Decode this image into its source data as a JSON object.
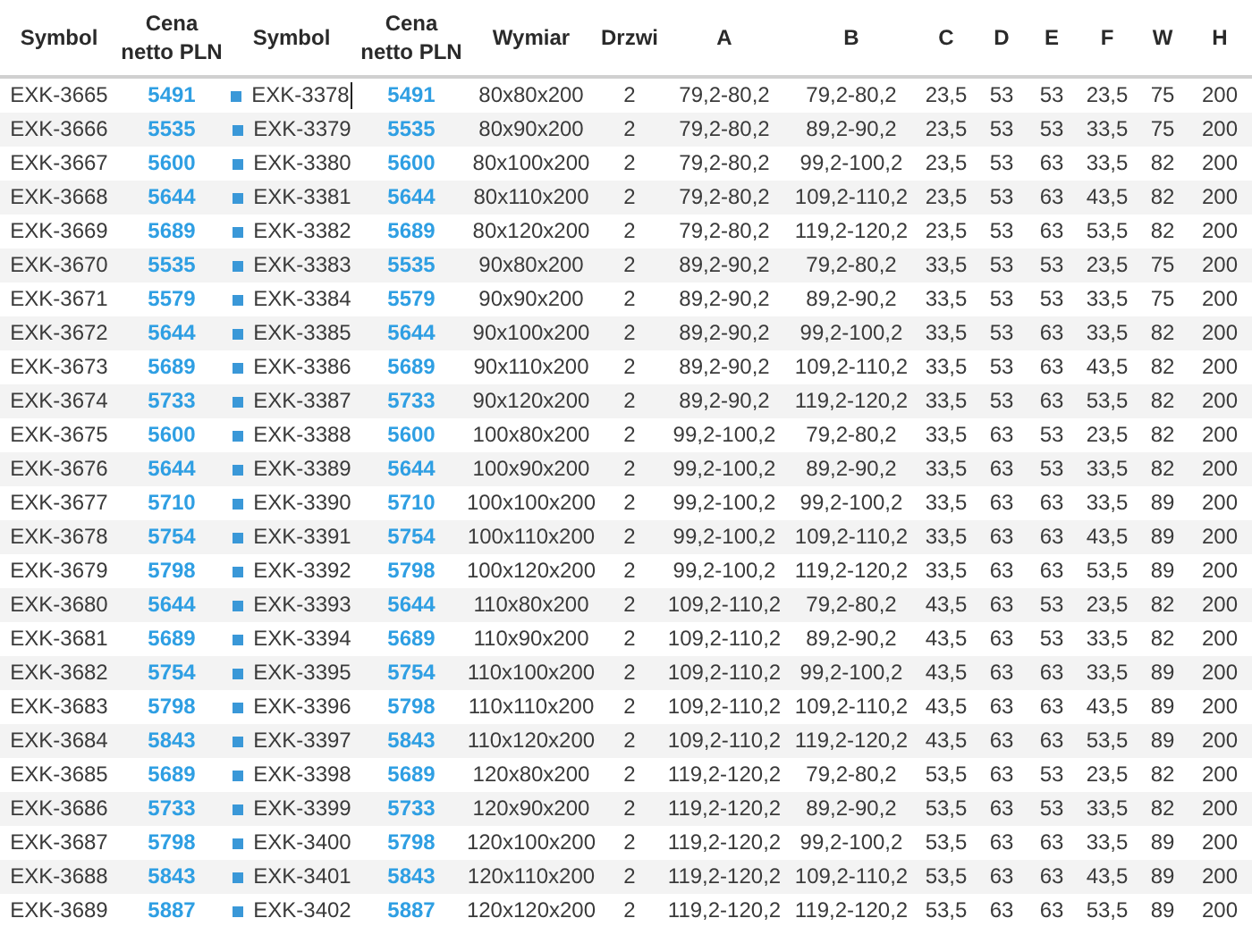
{
  "table": {
    "columns": [
      {
        "label": "Symbol",
        "kind": "text"
      },
      {
        "label": "Cena netto PLN",
        "kind": "price"
      },
      {
        "label": "Symbol",
        "kind": "marked"
      },
      {
        "label": "Cena netto PLN",
        "kind": "price"
      },
      {
        "label": "Wymiar",
        "kind": "text"
      },
      {
        "label": "Drzwi",
        "kind": "text"
      },
      {
        "label": "A",
        "kind": "text"
      },
      {
        "label": "B",
        "kind": "text"
      },
      {
        "label": "C",
        "kind": "text"
      },
      {
        "label": "D",
        "kind": "text"
      },
      {
        "label": "E",
        "kind": "text"
      },
      {
        "label": "F",
        "kind": "text"
      },
      {
        "label": "W",
        "kind": "text"
      },
      {
        "label": "H",
        "kind": "text"
      }
    ],
    "rows": [
      {
        "editing": true,
        "cells": [
          "EXK-3665",
          "5491",
          "EXK-3378",
          "5491",
          "80x80x200",
          "2",
          "79,2-80,2",
          "79,2-80,2",
          "23,5",
          "53",
          "53",
          "23,5",
          "75",
          "200"
        ]
      },
      {
        "editing": false,
        "cells": [
          "EXK-3666",
          "5535",
          "EXK-3379",
          "5535",
          "80x90x200",
          "2",
          "79,2-80,2",
          "89,2-90,2",
          "23,5",
          "53",
          "53",
          "33,5",
          "75",
          "200"
        ]
      },
      {
        "editing": false,
        "cells": [
          "EXK-3667",
          "5600",
          "EXK-3380",
          "5600",
          "80x100x200",
          "2",
          "79,2-80,2",
          "99,2-100,2",
          "23,5",
          "53",
          "63",
          "33,5",
          "82",
          "200"
        ]
      },
      {
        "editing": false,
        "cells": [
          "EXK-3668",
          "5644",
          "EXK-3381",
          "5644",
          "80x110x200",
          "2",
          "79,2-80,2",
          "109,2-110,2",
          "23,5",
          "53",
          "63",
          "43,5",
          "82",
          "200"
        ]
      },
      {
        "editing": false,
        "cells": [
          "EXK-3669",
          "5689",
          "EXK-3382",
          "5689",
          "80x120x200",
          "2",
          "79,2-80,2",
          "119,2-120,2",
          "23,5",
          "53",
          "63",
          "53,5",
          "82",
          "200"
        ]
      },
      {
        "editing": false,
        "cells": [
          "EXK-3670",
          "5535",
          "EXK-3383",
          "5535",
          "90x80x200",
          "2",
          "89,2-90,2",
          "79,2-80,2",
          "33,5",
          "53",
          "53",
          "23,5",
          "75",
          "200"
        ]
      },
      {
        "editing": false,
        "cells": [
          "EXK-3671",
          "5579",
          "EXK-3384",
          "5579",
          "90x90x200",
          "2",
          "89,2-90,2",
          "89,2-90,2",
          "33,5",
          "53",
          "53",
          "33,5",
          "75",
          "200"
        ]
      },
      {
        "editing": false,
        "cells": [
          "EXK-3672",
          "5644",
          "EXK-3385",
          "5644",
          "90x100x200",
          "2",
          "89,2-90,2",
          "99,2-100,2",
          "33,5",
          "53",
          "63",
          "33,5",
          "82",
          "200"
        ]
      },
      {
        "editing": false,
        "cells": [
          "EXK-3673",
          "5689",
          "EXK-3386",
          "5689",
          "90x110x200",
          "2",
          "89,2-90,2",
          "109,2-110,2",
          "33,5",
          "53",
          "63",
          "43,5",
          "82",
          "200"
        ]
      },
      {
        "editing": false,
        "cells": [
          "EXK-3674",
          "5733",
          "EXK-3387",
          "5733",
          "90x120x200",
          "2",
          "89,2-90,2",
          "119,2-120,2",
          "33,5",
          "53",
          "63",
          "53,5",
          "82",
          "200"
        ]
      },
      {
        "editing": false,
        "cells": [
          "EXK-3675",
          "5600",
          "EXK-3388",
          "5600",
          "100x80x200",
          "2",
          "99,2-100,2",
          "79,2-80,2",
          "33,5",
          "63",
          "53",
          "23,5",
          "82",
          "200"
        ]
      },
      {
        "editing": false,
        "cells": [
          "EXK-3676",
          "5644",
          "EXK-3389",
          "5644",
          "100x90x200",
          "2",
          "99,2-100,2",
          "89,2-90,2",
          "33,5",
          "63",
          "53",
          "33,5",
          "82",
          "200"
        ]
      },
      {
        "editing": false,
        "cells": [
          "EXK-3677",
          "5710",
          "EXK-3390",
          "5710",
          "100x100x200",
          "2",
          "99,2-100,2",
          "99,2-100,2",
          "33,5",
          "63",
          "63",
          "33,5",
          "89",
          "200"
        ]
      },
      {
        "editing": false,
        "cells": [
          "EXK-3678",
          "5754",
          "EXK-3391",
          "5754",
          "100x110x200",
          "2",
          "99,2-100,2",
          "109,2-110,2",
          "33,5",
          "63",
          "63",
          "43,5",
          "89",
          "200"
        ]
      },
      {
        "editing": false,
        "cells": [
          "EXK-3679",
          "5798",
          "EXK-3392",
          "5798",
          "100x120x200",
          "2",
          "99,2-100,2",
          "119,2-120,2",
          "33,5",
          "63",
          "63",
          "53,5",
          "89",
          "200"
        ]
      },
      {
        "editing": false,
        "cells": [
          "EXK-3680",
          "5644",
          "EXK-3393",
          "5644",
          "110x80x200",
          "2",
          "109,2-110,2",
          "79,2-80,2",
          "43,5",
          "63",
          "53",
          "23,5",
          "82",
          "200"
        ]
      },
      {
        "editing": false,
        "cells": [
          "EXK-3681",
          "5689",
          "EXK-3394",
          "5689",
          "110x90x200",
          "2",
          "109,2-110,2",
          "89,2-90,2",
          "43,5",
          "63",
          "53",
          "33,5",
          "82",
          "200"
        ]
      },
      {
        "editing": false,
        "cells": [
          "EXK-3682",
          "5754",
          "EXK-3395",
          "5754",
          "110x100x200",
          "2",
          "109,2-110,2",
          "99,2-100,2",
          "43,5",
          "63",
          "63",
          "33,5",
          "89",
          "200"
        ]
      },
      {
        "editing": false,
        "cells": [
          "EXK-3683",
          "5798",
          "EXK-3396",
          "5798",
          "110x110x200",
          "2",
          "109,2-110,2",
          "109,2-110,2",
          "43,5",
          "63",
          "63",
          "43,5",
          "89",
          "200"
        ]
      },
      {
        "editing": false,
        "cells": [
          "EXK-3684",
          "5843",
          "EXK-3397",
          "5843",
          "110x120x200",
          "2",
          "109,2-110,2",
          "119,2-120,2",
          "43,5",
          "63",
          "63",
          "53,5",
          "89",
          "200"
        ]
      },
      {
        "editing": false,
        "cells": [
          "EXK-3685",
          "5689",
          "EXK-3398",
          "5689",
          "120x80x200",
          "2",
          "119,2-120,2",
          "79,2-80,2",
          "53,5",
          "63",
          "53",
          "23,5",
          "82",
          "200"
        ]
      },
      {
        "editing": false,
        "cells": [
          "EXK-3686",
          "5733",
          "EXK-3399",
          "5733",
          "120x90x200",
          "2",
          "119,2-120,2",
          "89,2-90,2",
          "53,5",
          "63",
          "53",
          "33,5",
          "82",
          "200"
        ]
      },
      {
        "editing": false,
        "cells": [
          "EXK-3687",
          "5798",
          "EXK-3400",
          "5798",
          "120x100x200",
          "2",
          "119,2-120,2",
          "99,2-100,2",
          "53,5",
          "63",
          "63",
          "33,5",
          "89",
          "200"
        ]
      },
      {
        "editing": false,
        "cells": [
          "EXK-3688",
          "5843",
          "EXK-3401",
          "5843",
          "120x110x200",
          "2",
          "119,2-120,2",
          "109,2-110,2",
          "53,5",
          "63",
          "63",
          "43,5",
          "89",
          "200"
        ]
      },
      {
        "editing": false,
        "cells": [
          "EXK-3689",
          "5887",
          "EXK-3402",
          "5887",
          "120x120x200",
          "2",
          "119,2-120,2",
          "119,2-120,2",
          "53,5",
          "63",
          "63",
          "53,5",
          "89",
          "200"
        ]
      }
    ]
  }
}
